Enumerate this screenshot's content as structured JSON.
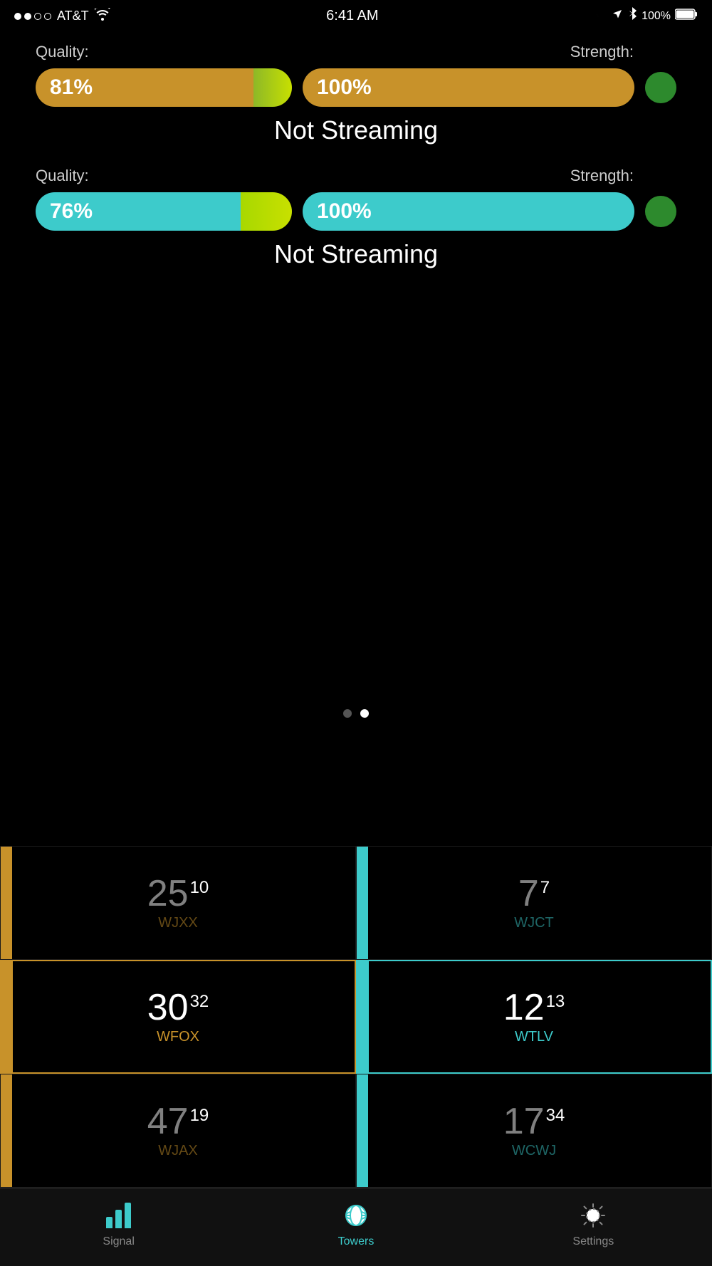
{
  "statusBar": {
    "carrier": "AT&T",
    "time": "6:41 AM",
    "battery": "100%"
  },
  "section1": {
    "qualityLabel": "Quality:",
    "strengthLabel": "Strength:",
    "qualityValue": "81%",
    "strengthValue": "100%",
    "statusText": "Not Streaming",
    "colorClass": "golden"
  },
  "section2": {
    "qualityLabel": "Quality:",
    "strengthLabel": "Strength:",
    "qualityValue": "76%",
    "strengthValue": "100%",
    "statusText": "Not Streaming",
    "colorClass": "cyan"
  },
  "pageIndicators": {
    "dots": [
      "inactive",
      "active"
    ]
  },
  "towers": [
    {
      "channel": "25",
      "sub": "10",
      "station": "WJXX",
      "color": "gold",
      "dimmed": true,
      "highlighted": false
    },
    {
      "channel": "7",
      "sub": "7",
      "station": "WJCT",
      "color": "cyan",
      "dimmed": true,
      "highlighted": false
    },
    {
      "channel": "30",
      "sub": "32",
      "station": "WFOX",
      "color": "gold",
      "dimmed": false,
      "highlighted": true
    },
    {
      "channel": "12",
      "sub": "13",
      "station": "WTLV",
      "color": "cyan",
      "dimmed": false,
      "highlighted": true
    },
    {
      "channel": "47",
      "sub": "19",
      "station": "WJAX",
      "color": "gold",
      "dimmed": true,
      "highlighted": false
    },
    {
      "channel": "17",
      "sub": "34",
      "station": "WCWJ",
      "color": "cyan",
      "dimmed": true,
      "highlighted": false
    }
  ],
  "tabs": [
    {
      "id": "signal",
      "label": "Signal",
      "active": false
    },
    {
      "id": "towers",
      "label": "Towers",
      "active": true
    },
    {
      "id": "settings",
      "label": "Settings",
      "active": false
    }
  ]
}
